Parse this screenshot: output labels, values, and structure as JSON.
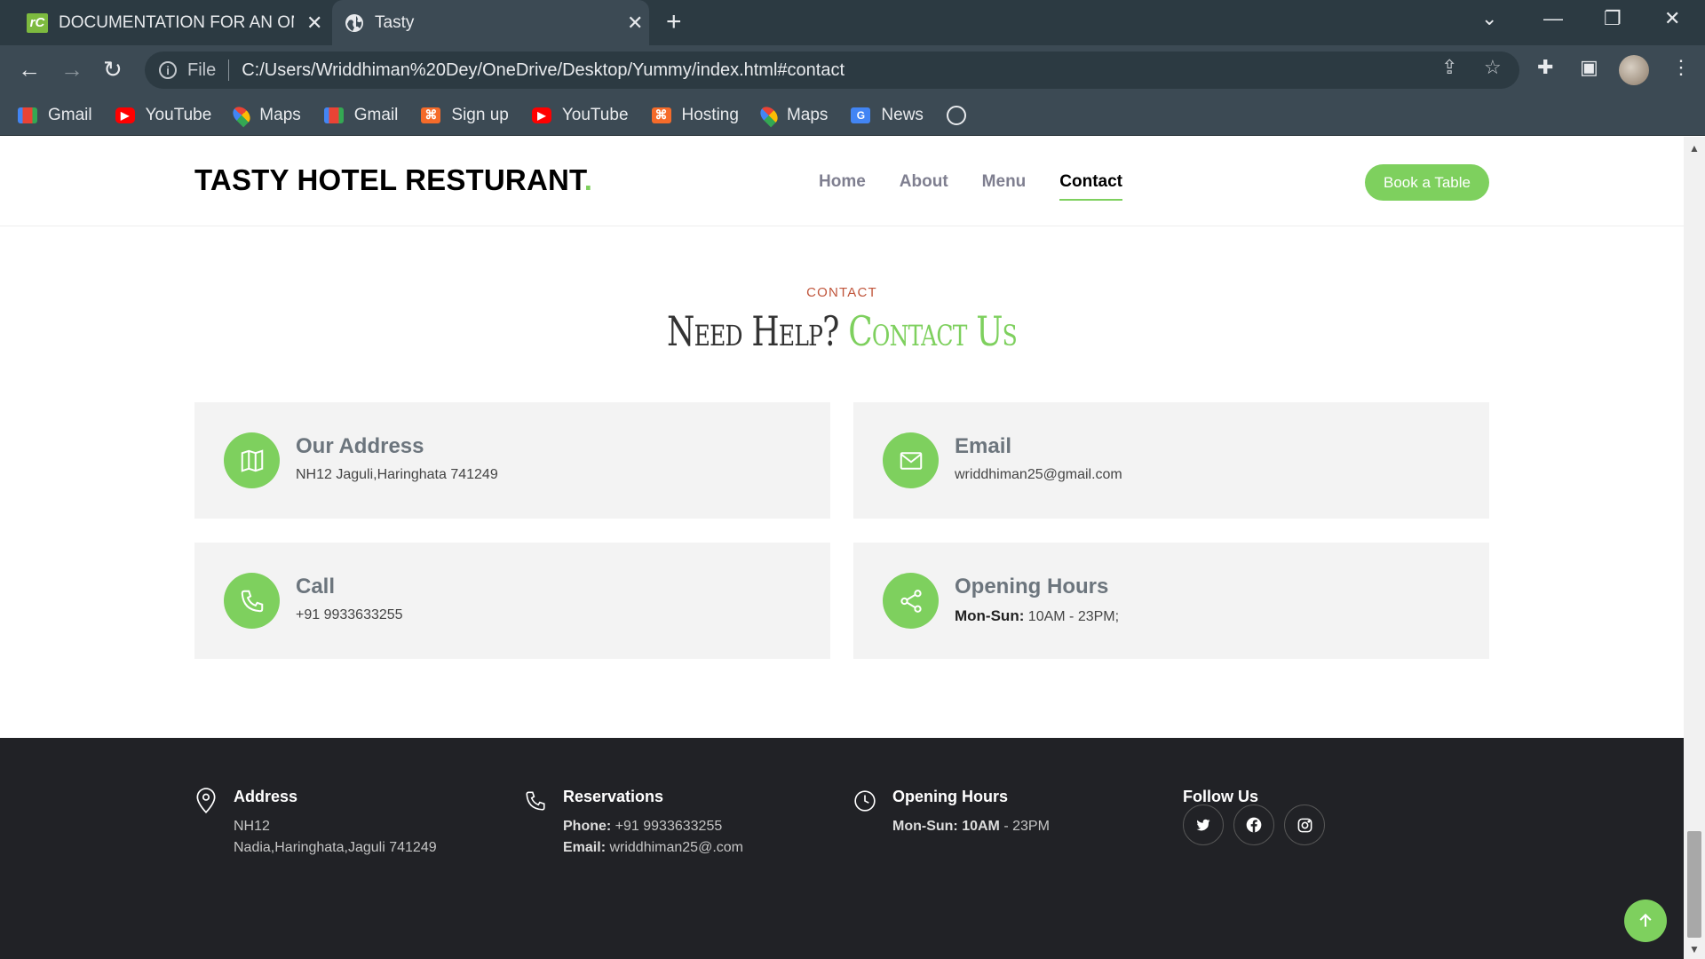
{
  "browser": {
    "tabs": [
      {
        "title": "DOCUMENTATION FOR AN ONLI",
        "favicon": "rC"
      },
      {
        "title": "Tasty"
      }
    ],
    "omnibox": {
      "scheme_label": "File",
      "url": "C:/Users/Wriddhiman%20Dey/OneDrive/Desktop/Yummy/index.html#contact"
    },
    "bookmarks": [
      {
        "label": "Gmail",
        "icon": "gmail-icon"
      },
      {
        "label": "YouTube",
        "icon": "youtube-icon"
      },
      {
        "label": "Maps",
        "icon": "maps-icon"
      },
      {
        "label": "Gmail",
        "icon": "gmail-icon"
      },
      {
        "label": "Sign up",
        "icon": "hosting-icon"
      },
      {
        "label": "YouTube",
        "icon": "youtube-icon"
      },
      {
        "label": "Hosting",
        "icon": "hosting-icon"
      },
      {
        "label": "Maps",
        "icon": "maps-icon"
      },
      {
        "label": "News",
        "icon": "news-icon"
      }
    ]
  },
  "site": {
    "logo": "TASTY HOTEL RESTURANT",
    "logo_dot": ".",
    "nav": [
      "Home",
      "About",
      "Menu",
      "Contact"
    ],
    "active_nav": "Contact",
    "book_button": "Book a Table",
    "accent_color": "#7ed05e"
  },
  "contact": {
    "eyebrow": "CONTACT",
    "title_part1": "Need Help?",
    "title_part2": "Contact Us",
    "cards": [
      {
        "title": "Our Address",
        "text": "NH12 Jaguli,Haringhata 741249",
        "icon": "map-icon"
      },
      {
        "title": "Email",
        "text": "wriddhiman25@gmail.com",
        "icon": "envelope-icon"
      },
      {
        "title": "Call",
        "text": "+91 9933633255",
        "icon": "phone-icon"
      },
      {
        "title": "Opening Hours",
        "label": "Mon-Sun:",
        "text": " 10AM - 23PM;",
        "icon": "share-icon"
      }
    ]
  },
  "footer": {
    "address": {
      "heading": "Address",
      "line1": "NH12",
      "line2": "Nadia,Haringhata,Jaguli 741249"
    },
    "reservations": {
      "heading": "Reservations",
      "phone_label": "Phone:",
      "phone": " +91 9933633255",
      "email_label": "Email:",
      "email": " wriddhiman25@.com"
    },
    "hours": {
      "heading": "Opening Hours",
      "days": "Mon-Sun:",
      "open": " 10AM",
      "close": " - 23PM"
    },
    "follow": {
      "heading": "Follow Us",
      "socials": [
        "twitter-icon",
        "facebook-icon",
        "instagram-icon"
      ]
    }
  }
}
